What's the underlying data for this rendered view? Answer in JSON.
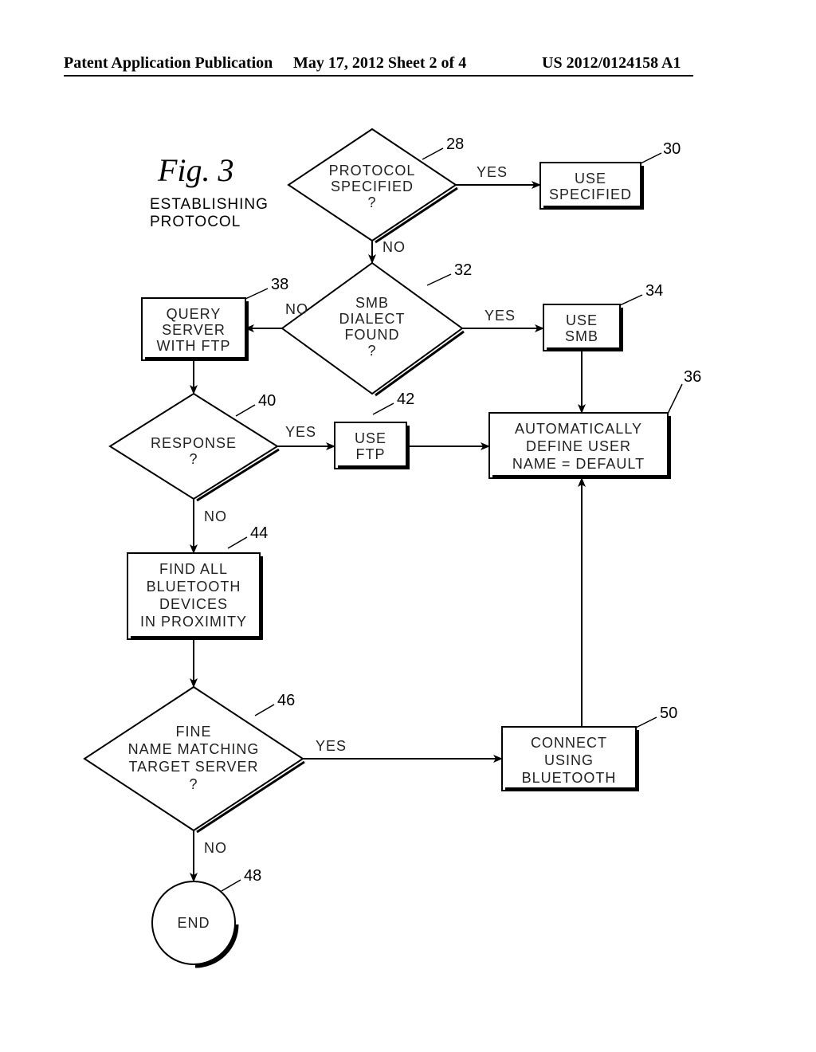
{
  "header": {
    "left": "Patent Application Publication",
    "center": "May 17, 2012  Sheet 2 of 4",
    "right": "US 2012/0124158 A1"
  },
  "figure": {
    "title": "Fig. 3",
    "caption_line1": "ESTABLISHING",
    "caption_line2": "PROTOCOL"
  },
  "refs": {
    "r28": "28",
    "r30": "30",
    "r32": "32",
    "r34": "34",
    "r36": "36",
    "r38": "38",
    "r40": "40",
    "r42": "42",
    "r44": "44",
    "r46": "46",
    "r48": "48",
    "r50": "50"
  },
  "nodes": {
    "d28_l1": "PROTOCOL",
    "d28_l2": "SPECIFIED",
    "d28_l3": "?",
    "b30_l1": "USE",
    "b30_l2": "SPECIFIED",
    "d32_l1": "SMB",
    "d32_l2": "DIALECT",
    "d32_l3": "FOUND",
    "d32_l4": "?",
    "b34_l1": "USE",
    "b34_l2": "SMB",
    "b36_l1": "AUTOMATICALLY",
    "b36_l2": "DEFINE  USER",
    "b36_l3": "NAME  =  DEFAULT",
    "b38_l1": "QUERY",
    "b38_l2": "SERVER",
    "b38_l3": "WITH  FTP",
    "d40_l1": "RESPONSE",
    "d40_l2": "?",
    "b42_l1": "USE",
    "b42_l2": "FTP",
    "b44_l1": "FIND  ALL",
    "b44_l2": "BLUETOOTH",
    "b44_l3": "DEVICES",
    "b44_l4": "IN  PROXIMITY",
    "d46_l1": "FINE",
    "d46_l2": "NAME  MATCHING",
    "d46_l3": "TARGET  SERVER",
    "d46_l4": "?",
    "b50_l1": "CONNECT",
    "b50_l2": "USING",
    "b50_l3": "BLUETOOTH",
    "end": "END"
  },
  "labels": {
    "yes": "YES",
    "no": "NO"
  },
  "chart_data": {
    "type": "flowchart",
    "title": "Fig. 3 — ESTABLISHING PROTOCOL",
    "nodes": [
      {
        "id": 28,
        "type": "decision",
        "text": "PROTOCOL SPECIFIED ?"
      },
      {
        "id": 30,
        "type": "process",
        "text": "USE SPECIFIED"
      },
      {
        "id": 32,
        "type": "decision",
        "text": "SMB DIALECT FOUND ?"
      },
      {
        "id": 34,
        "type": "process",
        "text": "USE SMB"
      },
      {
        "id": 36,
        "type": "process",
        "text": "AUTOMATICALLY DEFINE USER NAME = DEFAULT"
      },
      {
        "id": 38,
        "type": "process",
        "text": "QUERY SERVER WITH FTP"
      },
      {
        "id": 40,
        "type": "decision",
        "text": "RESPONSE ?"
      },
      {
        "id": 42,
        "type": "process",
        "text": "USE FTP"
      },
      {
        "id": 44,
        "type": "process",
        "text": "FIND ALL BLUETOOTH DEVICES IN PROXIMITY"
      },
      {
        "id": 46,
        "type": "decision",
        "text": "FINE NAME MATCHING TARGET SERVER ?"
      },
      {
        "id": 48,
        "type": "terminator",
        "text": "END"
      },
      {
        "id": 50,
        "type": "process",
        "text": "CONNECT USING BLUETOOTH"
      }
    ],
    "edges": [
      {
        "from": 28,
        "to": 30,
        "label": "YES"
      },
      {
        "from": 28,
        "to": 32,
        "label": "NO"
      },
      {
        "from": 32,
        "to": 34,
        "label": "YES"
      },
      {
        "from": 32,
        "to": 38,
        "label": "NO"
      },
      {
        "from": 34,
        "to": 36,
        "label": ""
      },
      {
        "from": 38,
        "to": 40,
        "label": ""
      },
      {
        "from": 40,
        "to": 42,
        "label": "YES"
      },
      {
        "from": 40,
        "to": 44,
        "label": "NO"
      },
      {
        "from": 42,
        "to": 36,
        "label": ""
      },
      {
        "from": 44,
        "to": 46,
        "label": ""
      },
      {
        "from": 46,
        "to": 50,
        "label": "YES"
      },
      {
        "from": 46,
        "to": 48,
        "label": "NO"
      },
      {
        "from": 50,
        "to": 36,
        "label": ""
      }
    ]
  }
}
